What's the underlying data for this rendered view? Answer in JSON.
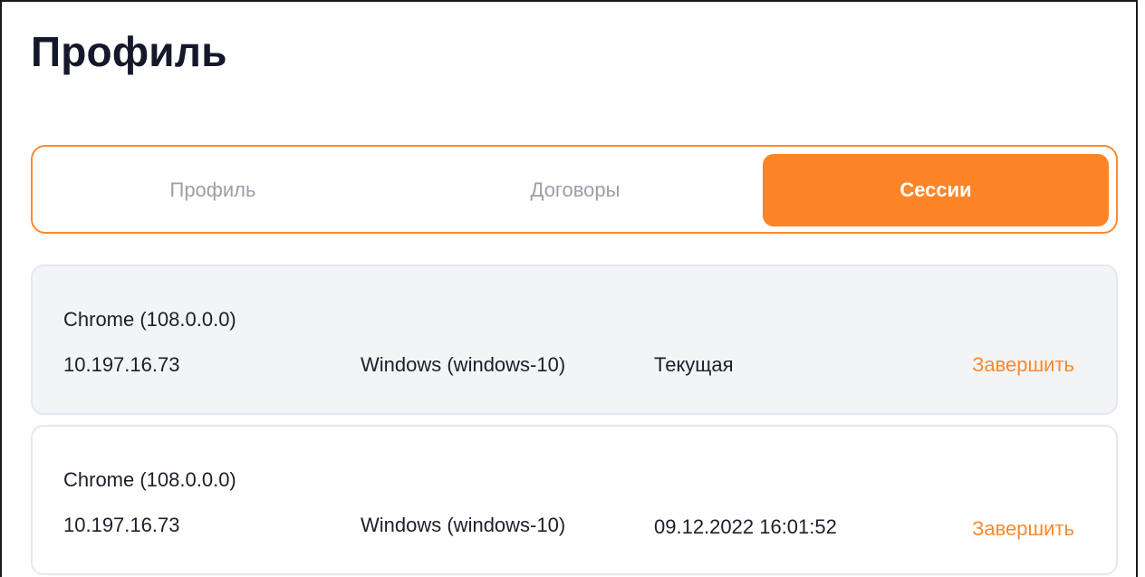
{
  "page": {
    "title": "Профиль"
  },
  "tabs": [
    {
      "label": "Профиль",
      "active": false
    },
    {
      "label": "Договоры",
      "active": false
    },
    {
      "label": "Сессии",
      "active": true
    }
  ],
  "sessions": [
    {
      "browser": "Chrome (108.0.0.0)",
      "ip": "10.197.16.73",
      "os": "Windows (windows-10)",
      "status": "Текущая",
      "end_label": "Завершить"
    },
    {
      "browser": "Chrome (108.0.0.0)",
      "ip": "10.197.16.73",
      "os": "Windows (windows-10)",
      "status": "09.12.2022 16:01:52",
      "end_label": "Завершить"
    }
  ],
  "colors": {
    "accent": "#fd8427",
    "title": "#15182b",
    "inactive_tab": "#9b9fa8",
    "current_card_bg": "#f3f4f6",
    "card_border": "#e3e8f2"
  }
}
